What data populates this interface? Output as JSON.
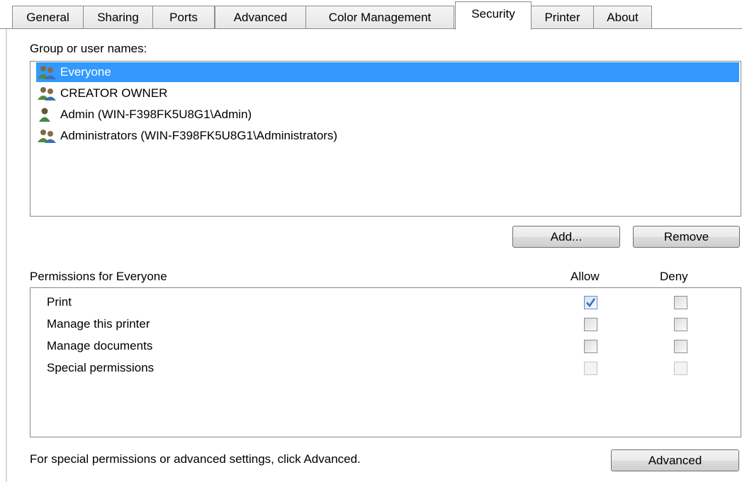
{
  "tabs": [
    {
      "label": "General",
      "active": false
    },
    {
      "label": "Sharing",
      "active": false
    },
    {
      "label": "Ports",
      "active": false
    },
    {
      "label": "Advanced",
      "active": false
    },
    {
      "label": "Color Management",
      "active": false
    },
    {
      "label": "Security",
      "active": true
    },
    {
      "label": "Printer",
      "active": false
    },
    {
      "label": "About",
      "active": false
    }
  ],
  "groups": {
    "label": "Group or user names:",
    "items": [
      {
        "name": "Everyone",
        "icon": "group-icon",
        "selected": true
      },
      {
        "name": "CREATOR OWNER",
        "icon": "group-icon",
        "selected": false
      },
      {
        "name": "Admin (WIN-F398FK5U8G1\\Admin)",
        "icon": "user-icon",
        "selected": false
      },
      {
        "name": "Administrators (WIN-F398FK5U8G1\\Administrators)",
        "icon": "group-icon",
        "selected": false
      }
    ],
    "add_label": "Add...",
    "remove_label": "Remove"
  },
  "permissions": {
    "label": "Permissions for Everyone",
    "allow_header": "Allow",
    "deny_header": "Deny",
    "rows": [
      {
        "name": "Print",
        "allow": true,
        "deny": false,
        "enabled": true
      },
      {
        "name": "Manage this printer",
        "allow": false,
        "deny": false,
        "enabled": true
      },
      {
        "name": "Manage documents",
        "allow": false,
        "deny": false,
        "enabled": true
      },
      {
        "name": "Special permissions",
        "allow": false,
        "deny": false,
        "enabled": false
      }
    ]
  },
  "footer": {
    "hint": "For special permissions or advanced settings, click Advanced.",
    "advanced_label": "Advanced"
  },
  "colors": {
    "selection": "#3399ff",
    "check": "#3e6fb5"
  }
}
